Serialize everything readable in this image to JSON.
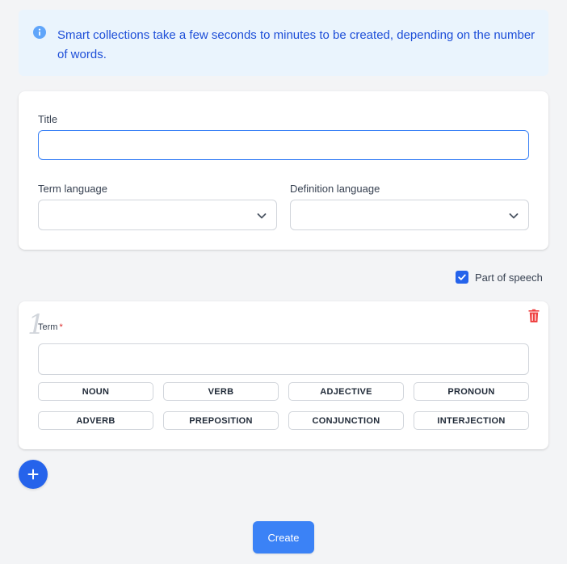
{
  "info": {
    "icon": "info-icon",
    "message": "Smart collections take a few seconds to minutes to be created, depending on the number of words."
  },
  "form": {
    "title_label": "Title",
    "title_value": "",
    "term_language_label": "Term language",
    "term_language_value": "",
    "definition_language_label": "Definition language",
    "definition_language_value": ""
  },
  "part_of_speech": {
    "label": "Part of speech",
    "checked": true
  },
  "term_card": {
    "index": "1",
    "term_label": "Term",
    "required_mark": "*",
    "term_value": "",
    "pos_buttons": [
      "NOUN",
      "VERB",
      "ADJECTIVE",
      "PRONOUN",
      "ADVERB",
      "PREPOSITION",
      "CONJUNCTION",
      "INTERJECTION"
    ]
  },
  "actions": {
    "add_icon": "plus-icon",
    "create_label": "Create"
  },
  "colors": {
    "accent": "#2563eb",
    "info_bg": "#eaf4fd",
    "info_text": "#1d4ed8",
    "danger": "#ef4444"
  }
}
